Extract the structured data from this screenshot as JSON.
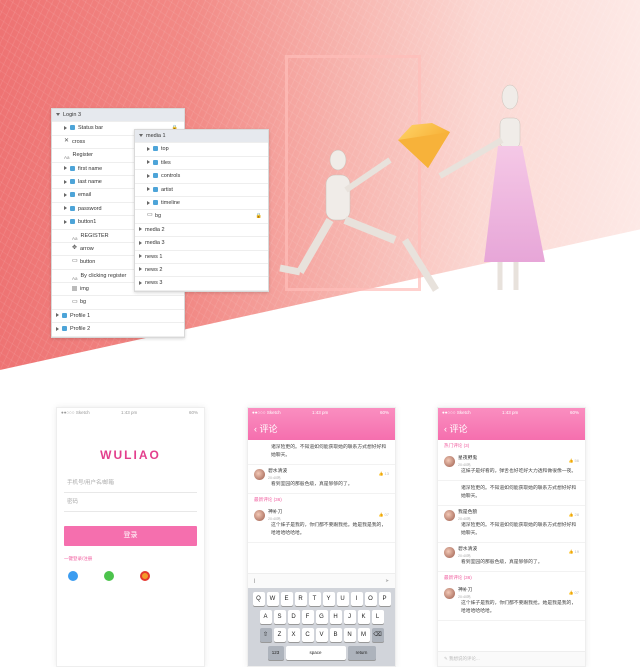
{
  "layers_panel": {
    "login_group": "Login 3",
    "items": [
      {
        "label": "Status bar",
        "icon": "folder-icon",
        "locked": true
      },
      {
        "label": "cross",
        "icon": "cross-icon"
      },
      {
        "label": "Register",
        "icon": "text-icon"
      },
      {
        "label": "first name",
        "icon": "folder-icon"
      },
      {
        "label": "last name",
        "icon": "folder-icon"
      },
      {
        "label": "email",
        "icon": "folder-icon"
      },
      {
        "label": "password",
        "icon": "folder-icon"
      },
      {
        "label": "button1",
        "icon": "folder-icon"
      },
      {
        "label": "REGISTER",
        "icon": "text-icon"
      },
      {
        "label": "arrow",
        "icon": "arrow-icon"
      },
      {
        "label": "button",
        "icon": "shape-icon"
      },
      {
        "label": "By clicking register",
        "icon": "text-icon"
      },
      {
        "label": "img",
        "icon": "image-icon"
      },
      {
        "label": "bg",
        "icon": "shape-icon"
      },
      {
        "label": "Profile 1",
        "icon": "folder-icon"
      },
      {
        "label": "Profile 2",
        "icon": "folder-icon"
      }
    ]
  },
  "media_panel": {
    "group": "media 1",
    "items": [
      {
        "label": "top"
      },
      {
        "label": "tiles"
      },
      {
        "label": "controls"
      },
      {
        "label": "artist"
      },
      {
        "label": "timeline"
      },
      {
        "label": "bg",
        "locked": true
      }
    ],
    "after": [
      "media 2",
      "media 3",
      "news 1",
      "news 2",
      "news 3"
    ]
  },
  "status": {
    "carrier": "●●○○○ Sketch",
    "time": "1:43 pm",
    "battery": "60%"
  },
  "login_screen": {
    "logo": "WULIAO",
    "phone_placeholder": "手机号/用户名/邮箱",
    "password_placeholder": "密码",
    "login_button": "登录",
    "register_link": "一键登录/注册"
  },
  "comments_screen_a": {
    "title": "评论",
    "top_text": "诸深险更的。不知道如何能获取她的联系方式想好好和她聊天。",
    "comments": [
      {
        "name": "碧水清波",
        "time": "20:40吗",
        "likes": "13",
        "text": "看到室园的那般色级，真是够够的了。"
      }
    ],
    "section": "最新评论 (36)",
    "comments2": [
      {
        "name": "神补刀",
        "time": "20:40吗",
        "likes": "07",
        "text": "这个妹子是我的，你们都不要跟我抢。她是我是我的，哈哈哈哈哈哈。"
      }
    ],
    "keyboard": {
      "row1": [
        "Q",
        "W",
        "E",
        "R",
        "T",
        "Y",
        "U",
        "I",
        "O",
        "P"
      ],
      "row2": [
        "A",
        "S",
        "D",
        "F",
        "G",
        "H",
        "J",
        "K",
        "L"
      ],
      "row3": [
        "Z",
        "X",
        "C",
        "V",
        "B",
        "N",
        "M"
      ],
      "row4": [
        "123",
        "space",
        "return"
      ]
    }
  },
  "comments_screen_b": {
    "title": "评论",
    "hot_section": "热门评论 (3)",
    "comments": [
      {
        "name": "星夜野鬼",
        "time": "20:40吗",
        "likes": "56",
        "text": "这妹子是好看的。弹舌也好吃好大力透和做很像一夜。"
      },
      {
        "name": "",
        "time": "",
        "likes": "",
        "text": "诸深险更的。不知道如何能获取她的联系方式想好好和她聊天。"
      },
      {
        "name": "我是色狼",
        "time": "20:40吗",
        "likes": "28",
        "text": "诸深险更的。不知道如何能获取她的联系方式想好好和她聊天。"
      },
      {
        "name": "碧水清波",
        "time": "20:40吗",
        "likes": "19",
        "text": "看到室园的那般色级，真是够够的了。"
      }
    ],
    "section": "最新评论 (36)",
    "comments2": [
      {
        "name": "神补刀",
        "time": "20:40吗",
        "likes": "07",
        "text": "这个妹子是我的，你们都不要跟我抢。她是我是我的，哈哈哈哈哈哈。"
      }
    ],
    "input_placeholder": "我想说的评论..."
  }
}
